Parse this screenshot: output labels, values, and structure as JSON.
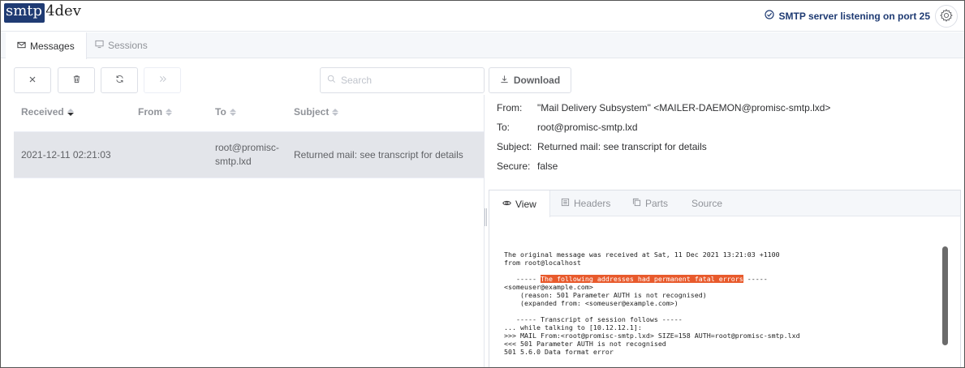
{
  "header": {
    "logo_box": "smtp",
    "logo_tail": "4dev",
    "status_text": "SMTP server listening on port 25",
    "status_icon": "check-circle-icon",
    "settings_icon": "gear-icon"
  },
  "tabs": [
    {
      "label": "Messages",
      "icon": "envelope-icon",
      "active": true
    },
    {
      "label": "Sessions",
      "icon": "monitor-icon",
      "active": false
    }
  ],
  "toolbar": {
    "clear_icon": "close-icon",
    "delete_icon": "trash-icon",
    "refresh_icon": "refresh-icon",
    "relay_icon": "double-chevron-right-icon",
    "search_placeholder": "Search",
    "download_label": "Download"
  },
  "list": {
    "columns": [
      "Received",
      "From",
      "To",
      "Subject"
    ],
    "sorted_column": "Received",
    "rows": [
      {
        "received": "2021-12-11 02:21:03",
        "from": "",
        "to_line1": "root@promisc-",
        "to_line2": "smtp.lxd",
        "subject": "Returned mail: see transcript for details"
      }
    ]
  },
  "message": {
    "from_label": "From:",
    "from_value": "\"Mail Delivery Subsystem\" <MAILER-DAEMON@promisc-smtp.lxd>",
    "to_label": "To:",
    "to_value": "root@promisc-smtp.lxd",
    "subject_label": "Subject:",
    "subject_value": "Returned mail: see transcript for details",
    "secure_label": "Secure:",
    "secure_value": "false"
  },
  "viewer": {
    "tabs": [
      {
        "label": "View",
        "icon": "eye-icon",
        "active": true
      },
      {
        "label": "Headers",
        "icon": "list-icon",
        "active": false
      },
      {
        "label": "Parts",
        "icon": "copy-icon",
        "active": false
      },
      {
        "label": "Source",
        "icon": "",
        "active": false
      }
    ],
    "lines": [
      "The original message was received at Sat, 11 Dec 2021 13:21:03 +1100",
      "from root@localhost",
      "",
      "   ----- ",
      "<someuser@example.com>",
      "    (reason: 501 Parameter AUTH is not recognised)",
      "    (expanded from: <someuser@example.com>)",
      "",
      "   ----- Transcript of session follows -----",
      "... while talking to [10.12.12.1]:",
      ">>> MAIL From:<root@promisc-smtp.lxd> SIZE=158 AUTH=root@promisc-smtp.lxd",
      "<<< 501 Parameter AUTH is not recognised",
      "501 5.6.0 Data format error"
    ],
    "highlight_text": "The following addresses had permanent fatal errors",
    "highlight_suffix": " -----",
    "highlight_color": "#e85a2c"
  }
}
